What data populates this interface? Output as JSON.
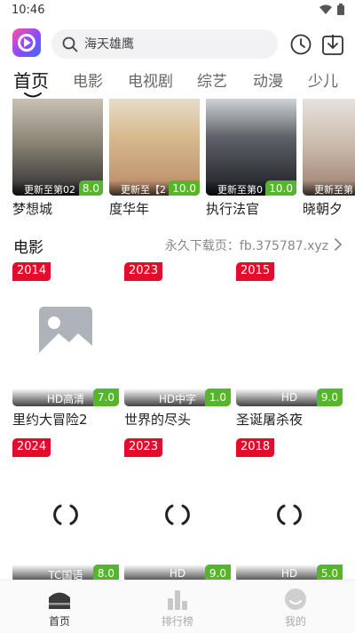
{
  "status_bar": {
    "time": "10:46"
  },
  "search": {
    "placeholder": "海天雄鹰"
  },
  "tabs": [
    {
      "label": "首页",
      "active": true
    },
    {
      "label": "电影"
    },
    {
      "label": "电视剧"
    },
    {
      "label": "综艺"
    },
    {
      "label": "动漫"
    },
    {
      "label": "少儿"
    }
  ],
  "top_row": [
    {
      "title": "梦想城",
      "update": "更新至第02",
      "score": "8.0"
    },
    {
      "title": "度华年",
      "update": "更新至【2",
      "score": "10.0"
    },
    {
      "title": "执行法官",
      "update": "更新至第0",
      "score": "10.0"
    },
    {
      "title": "晓朝夕",
      "update": "更新至第"
    }
  ],
  "section": {
    "title": "电影",
    "link": "永久下载页：fb.375787.xyz"
  },
  "movies": [
    {
      "year": "2014",
      "quality": "HD高清",
      "score": "7.0",
      "title": "里约大冒险2"
    },
    {
      "year": "2023",
      "quality": "HD中字",
      "score": "1.0",
      "title": "世界的尽头"
    },
    {
      "year": "2015",
      "quality": "HD",
      "score": "9.0",
      "title": "圣诞屠杀夜"
    },
    {
      "year": "2024",
      "quality": "TC国语",
      "score": "8.0"
    },
    {
      "year": "2023",
      "quality": "HD",
      "score": "9.0"
    },
    {
      "year": "2018",
      "quality": "HD",
      "score": "5.0"
    }
  ],
  "bottom_nav": [
    {
      "label": "首页",
      "icon": "home-icon",
      "active": true
    },
    {
      "label": "排行榜",
      "icon": "ranking-icon"
    },
    {
      "label": "我的",
      "icon": "profile-icon"
    }
  ],
  "colors": {
    "year_badge": "#e60b2a",
    "score_badge": "#56b52a",
    "tab_active": "#111111",
    "tab_inactive": "#666666"
  }
}
